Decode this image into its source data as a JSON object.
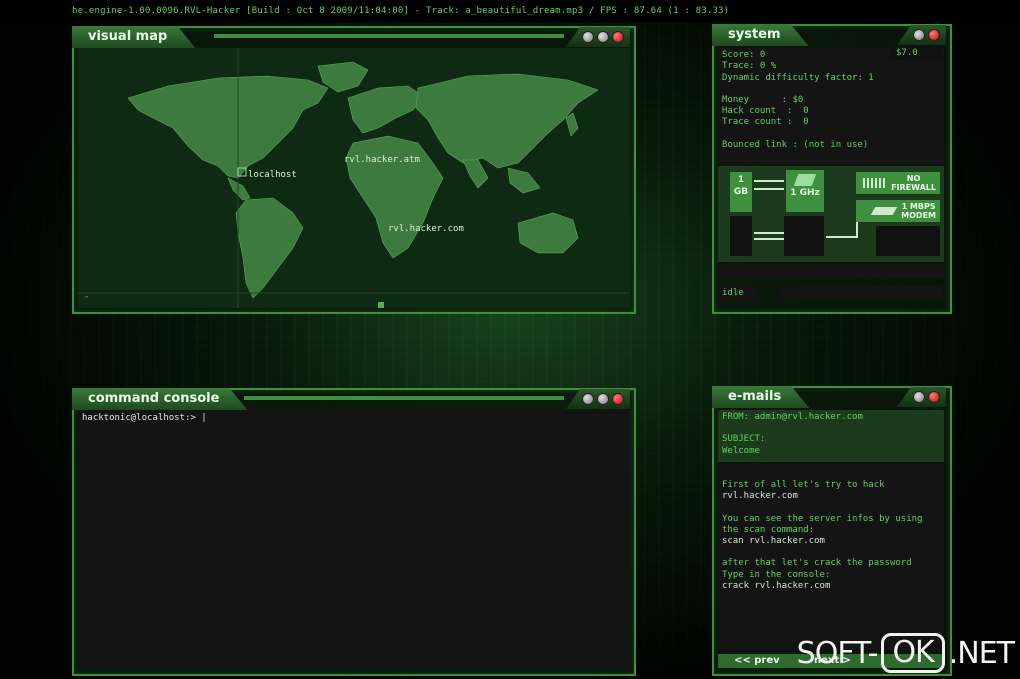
{
  "topbar": {
    "text": "he.engine-1.00.0096.RVL-Hacker [Build : Oct  8 2009/11:04:00] - Track: a_beautiful_dream.mp3 / FPS : 87.64 (1 : 83.33)"
  },
  "visual_map": {
    "title": "visual map",
    "labels": {
      "localhost": "localhost",
      "atm": "rvl.hacker.atm",
      "com": "rvl.hacker.com"
    },
    "scroll_marker": "-"
  },
  "system": {
    "title": "system",
    "score": "Score: 0",
    "trace": "Trace: 0 %",
    "difficulty": "Dynamic difficulty factor: 1",
    "version": "$7.0",
    "money": "Money      : $0",
    "hack_count": "Hack count  :  0",
    "trace_count": "Trace count :  0",
    "bounced": "Bounced link : (not in use)",
    "hw_ram": "1\nGB",
    "hw_cpu": "1 GHz",
    "hw_firewall": "NO\nFIREWALL",
    "hw_modem": "1 MBPS\nMODEM",
    "status": "idle"
  },
  "console": {
    "title": "command console",
    "prompt": "hacktonic@localhost:> |"
  },
  "emails": {
    "title": "e-mails",
    "from": "FROM:  admin@rvl.hacker.com",
    "subject_label": "SUBJECT:",
    "subject": "Welcome",
    "body": [
      "First of all let's try to hack",
      "rvl.hacker.com",
      "",
      "You can see the server infos by using",
      "the scan command:",
      "scan rvl.hacker.com",
      "",
      "after that let's crack the password",
      "Type in the console:",
      "crack rvl.hacker.com"
    ],
    "prev": "<< prev",
    "next": "next >"
  },
  "watermark": {
    "left": "SOFT-",
    "mid": "OK",
    "right": ".NET"
  },
  "colors": {
    "accent": "#3e8f3e",
    "text": "#5fd35f",
    "close": "#c00000"
  }
}
